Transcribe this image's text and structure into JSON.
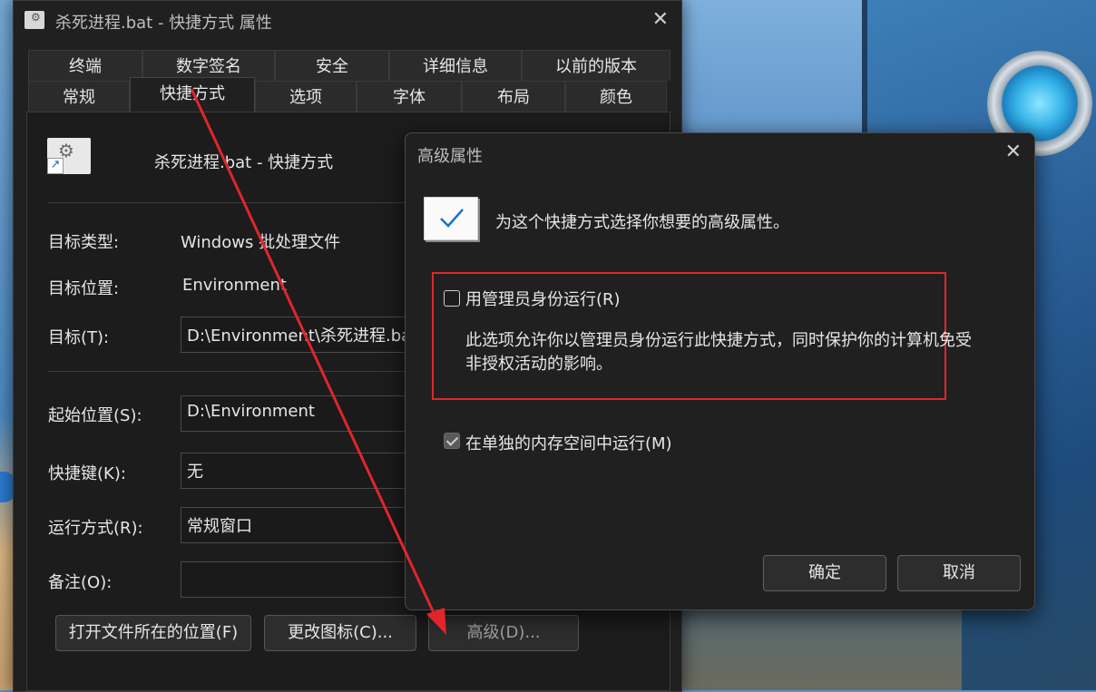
{
  "window": {
    "title": "杀死进程.bat - 快捷方式 属性",
    "close": "✕"
  },
  "tabs": {
    "row1": [
      "终端",
      "数字签名",
      "安全",
      "详细信息",
      "以前的版本"
    ],
    "row2": [
      "常规",
      "快捷方式",
      "选项",
      "字体",
      "布局",
      "颜色"
    ],
    "active": "快捷方式"
  },
  "shortcut": {
    "name": "杀死进程.bat - 快捷方式",
    "icon": "gear-shortcut-icon"
  },
  "fields": {
    "target_type_label": "目标类型:",
    "target_type_value": "Windows 批处理文件",
    "target_location_label": "目标位置:",
    "target_location_value": "Environment",
    "target_label": "目标(T):",
    "target_value": "D:\\Environment\\杀死进程.bat",
    "start_in_label": "起始位置(S):",
    "start_in_value": "D:\\Environment",
    "hotkey_label": "快捷键(K):",
    "hotkey_value": "无",
    "run_label": "运行方式(R):",
    "run_value": "常规窗口",
    "comment_label": "备注(O):",
    "comment_value": ""
  },
  "buttons": {
    "open_location": "打开文件所在的位置(F)",
    "change_icon": "更改图标(C)...",
    "advanced": "高级(D)..."
  },
  "dialog": {
    "title": "高级属性",
    "close": "✕",
    "intro": "为这个快捷方式选择你想要的高级属性。",
    "run_as_admin": "用管理员身份运行(R)",
    "run_as_admin_checked": false,
    "description": "此选项允许你以管理员身份运行此快捷方式，同时保护你的计算机免受非授权活动的影响。",
    "separate_memory": "在单独的内存空间中运行(M)",
    "separate_memory_checked": true,
    "ok": "确定",
    "cancel": "取消"
  },
  "colors": {
    "highlight": "#e0262b",
    "window_bg": "#202020"
  }
}
